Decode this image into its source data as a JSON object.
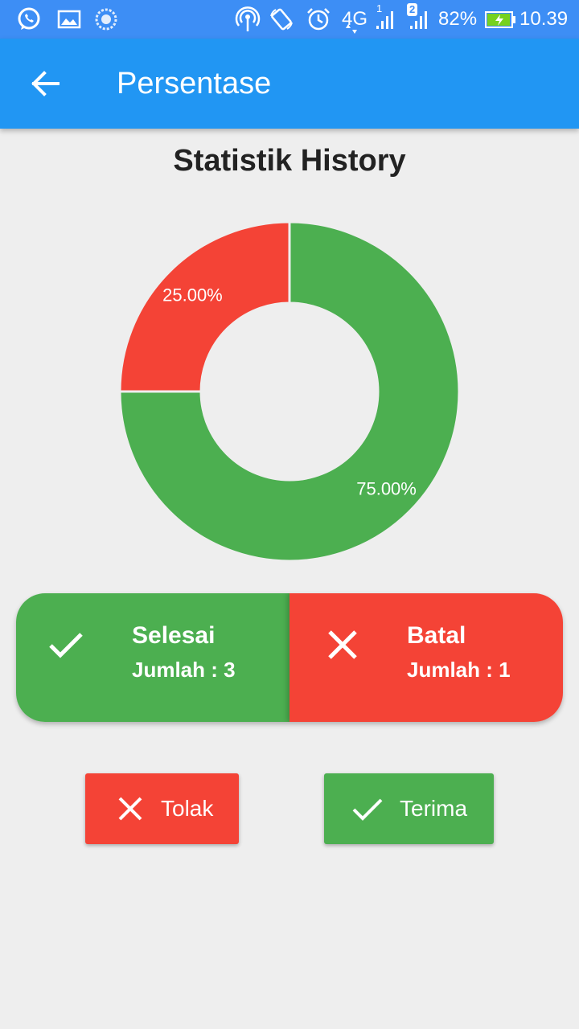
{
  "status_bar": {
    "icons": [
      "whatsapp-icon",
      "image-icon",
      "sync-icon",
      "hotspot-icon",
      "rotate-icon",
      "alarm-icon",
      "signal-icon",
      "signal-icon",
      "battery-charging-icon"
    ],
    "network": "4G",
    "sim1": "1",
    "sim2": "2",
    "battery": "82%",
    "time": "10.39"
  },
  "app_bar": {
    "back_icon": "arrow-back-icon",
    "title": "Persentase"
  },
  "chart_title": "Statistik History",
  "chart_data": {
    "type": "pie",
    "title": "Statistik History",
    "slices": [
      {
        "label": "Selesai",
        "value": 75.0,
        "display": "75.00%",
        "color": "#4caf50"
      },
      {
        "label": "Batal",
        "value": 25.0,
        "display": "25.00%",
        "color": "#f44336"
      }
    ]
  },
  "summary": {
    "selesai": {
      "title": "Selesai",
      "count_label": "Jumlah : 3",
      "icon": "check-icon",
      "color": "#4caf50"
    },
    "batal": {
      "title": "Batal",
      "count_label": "Jumlah : 1",
      "icon": "close-icon",
      "color": "#f44336"
    }
  },
  "actions": {
    "tolak": {
      "label": "Tolak",
      "icon": "close-icon",
      "color": "#f44336"
    },
    "terima": {
      "label": "Terima",
      "icon": "check-icon",
      "color": "#4caf50"
    }
  },
  "colors": {
    "status_bar": "#3d8ef5",
    "app_bar": "#2196f3",
    "background": "#eeeeee",
    "green": "#4caf50",
    "red": "#f44336"
  }
}
